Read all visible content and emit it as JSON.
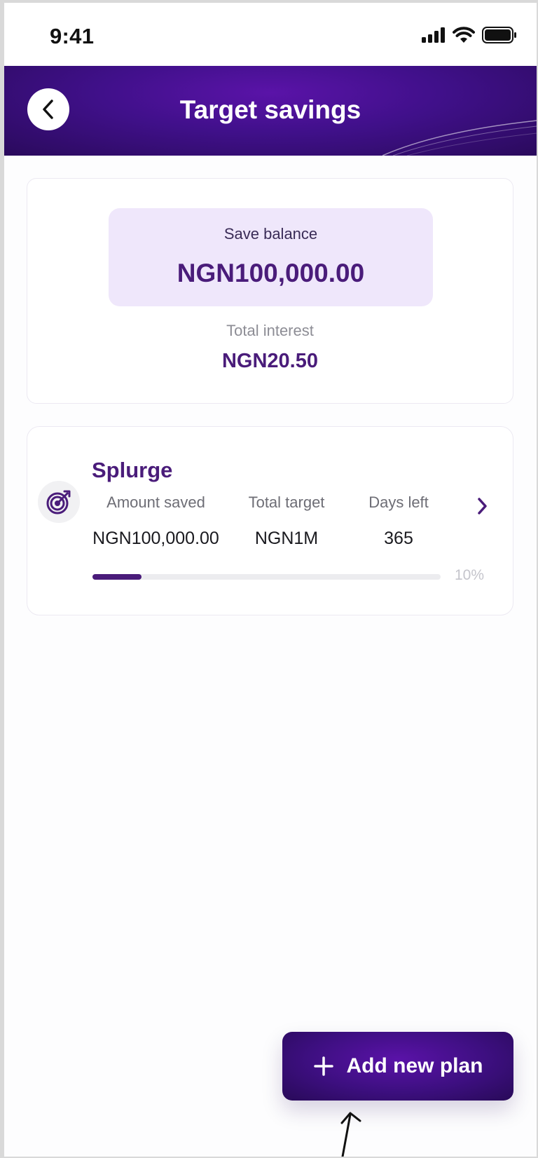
{
  "status_bar": {
    "time": "9:41",
    "icons": [
      "signal-icon",
      "wifi-icon",
      "battery-icon"
    ]
  },
  "header": {
    "title": "Target savings",
    "back_icon": "chevron-left-icon",
    "colors": {
      "gradient_start": "#5a13a8",
      "gradient_end": "#2a0a5c"
    }
  },
  "balance": {
    "label": "Save balance",
    "value": "NGN100,000.00",
    "interest_label": "Total interest",
    "interest_value": "NGN20.50"
  },
  "plans": [
    {
      "icon": "target-icon",
      "name": "Splurge",
      "amount_saved_label": "Amount saved",
      "amount_saved": "NGN100,000.00",
      "total_target_label": "Total target",
      "total_target": "NGN1M",
      "days_left_label": "Days left",
      "days_left": "365",
      "progress_fraction": 0.14,
      "progress_text": "10%"
    }
  ],
  "actions": {
    "add_plan_label": "Add new plan",
    "add_plan_icon": "plus-icon"
  },
  "colors": {
    "accent": "#4a1c7a",
    "balance_box_bg": "#efe7fb",
    "button_gradient": "#3d0f80"
  }
}
